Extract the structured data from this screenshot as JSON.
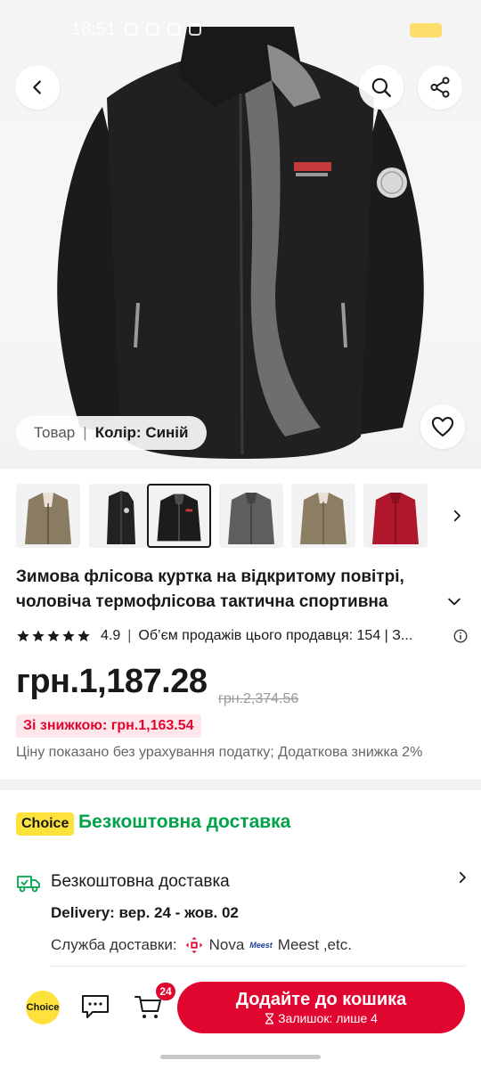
{
  "status_bar": {
    "time": "18:51"
  },
  "hero": {
    "variant_label": "Товар",
    "variant_separator": "|",
    "variant_value": "Колір: Синій"
  },
  "thumbnails": [
    {
      "name": "thumb-khaki-lined",
      "color": "#8a7b63"
    },
    {
      "name": "thumb-black-side",
      "color": "#222222"
    },
    {
      "name": "thumb-black",
      "color": "#1c1c1c",
      "selected": true
    },
    {
      "name": "thumb-grey",
      "color": "#5e5e5e"
    },
    {
      "name": "thumb-khaki",
      "color": "#8c7e63"
    },
    {
      "name": "thumb-red",
      "color": "#b0172d"
    }
  ],
  "product": {
    "title": "Зимова флісова куртка на відкритому повітрі, чоловіча термофлісова тактична спортивна куртк...",
    "rating": "4.9",
    "rating_separator": "|",
    "sales": "Об’єм продажів цього продавця: 154 | З...",
    "price": "грн.1,187.28",
    "old_price": "грн.2,374.56",
    "coupon": "Зі знижкою: грн.1,163.54",
    "tax_note": "Ціну показано без урахування податку; Додаткова знижка 2%"
  },
  "delivery": {
    "choice_badge": "Choice",
    "free_title": "Безкоштовна доставка",
    "shipping_title": "Безкоштовна доставка",
    "delivery_date": "Delivery: вер. 24 - жов. 02",
    "services_label": "Служба доставки:",
    "service_1": "Nova",
    "service_2_logo": "Meest",
    "service_2": "Meest ,etc."
  },
  "bottom_bar": {
    "choice_label": "Choice",
    "cart_count": "24",
    "add_to_cart": "Додайте до кошика",
    "stock": "Залишок: лише 4"
  },
  "colors": {
    "accent_red": "#e1062f",
    "choice_yellow": "#fde23c",
    "free_green": "#00a34a"
  }
}
